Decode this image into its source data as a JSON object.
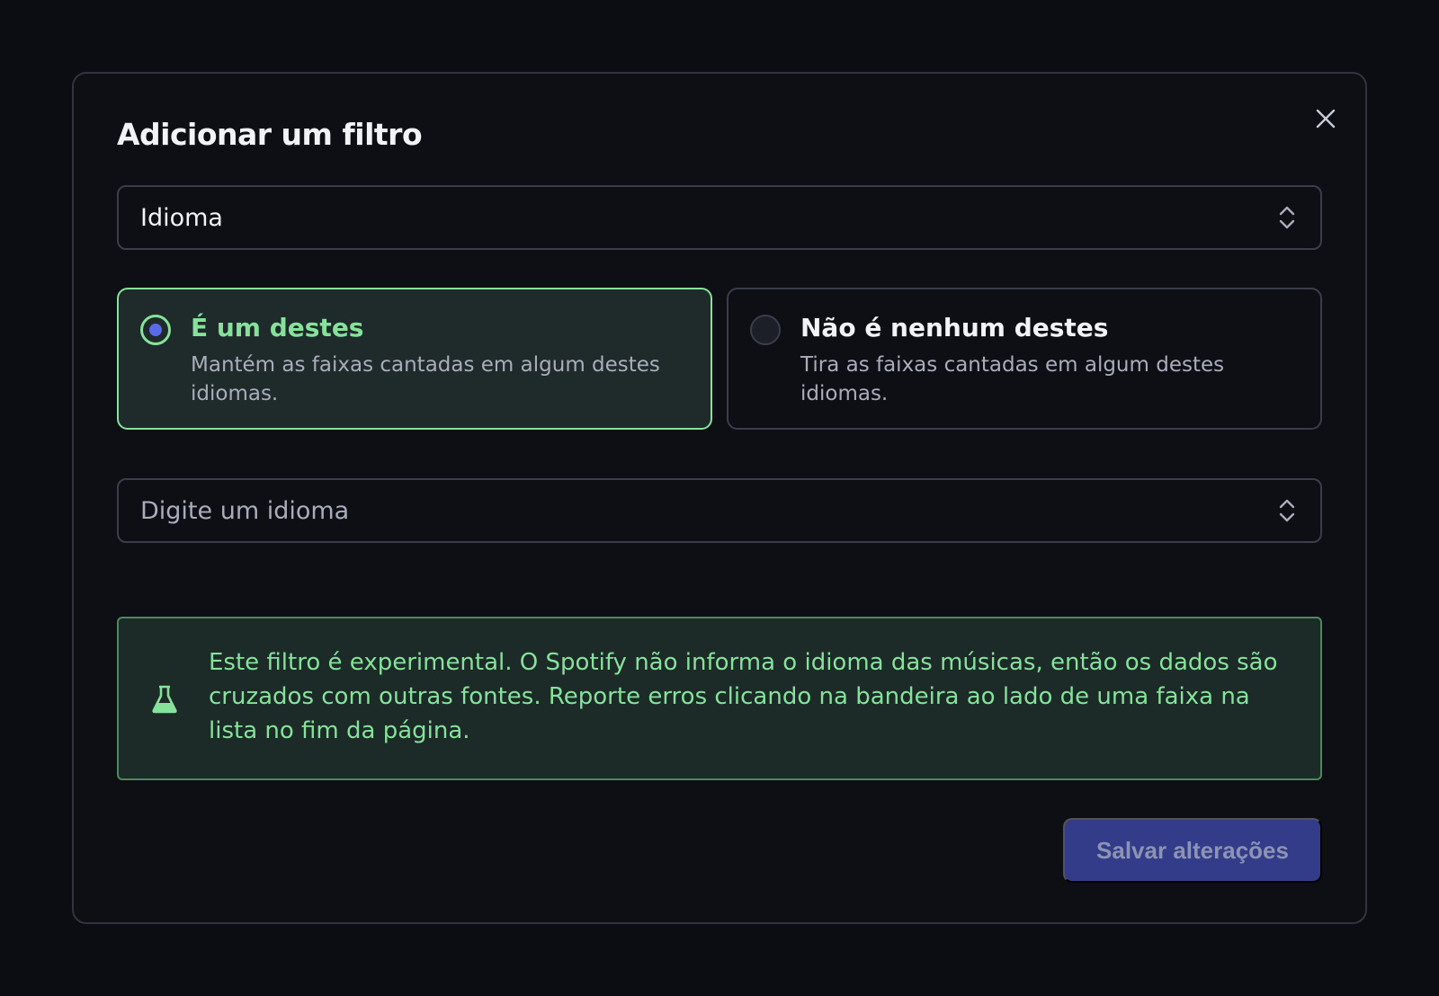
{
  "modal": {
    "title": "Adicionar um filtro",
    "close_icon": "close-icon"
  },
  "filter_type_select": {
    "value": "Idioma",
    "icon": "chevron-up-down-icon"
  },
  "options": [
    {
      "title": "É um destes",
      "description": "Mantém as faixas cantadas em algum destes idiomas.",
      "selected": true
    },
    {
      "title": "Não é nenhum destes",
      "description": "Tira as faixas cantadas em algum destes idiomas.",
      "selected": false
    }
  ],
  "language_select": {
    "placeholder": "Digite um idioma",
    "icon": "chevron-up-down-icon"
  },
  "notice": {
    "icon": "flask-icon",
    "text": "Este filtro é experimental. O Spotify não informa o idioma das músicas, então os dados são cruzados com outras fontes. Reporte erros clicando na bandeira ao lado de uma faixa na lista no fim da página."
  },
  "footer": {
    "save_label": "Salvar alterações"
  },
  "colors": {
    "accent_green": "#86e29b",
    "primary_button": "#323c88",
    "radio_dot": "#5b6ae8",
    "background": "#0b0d12"
  }
}
